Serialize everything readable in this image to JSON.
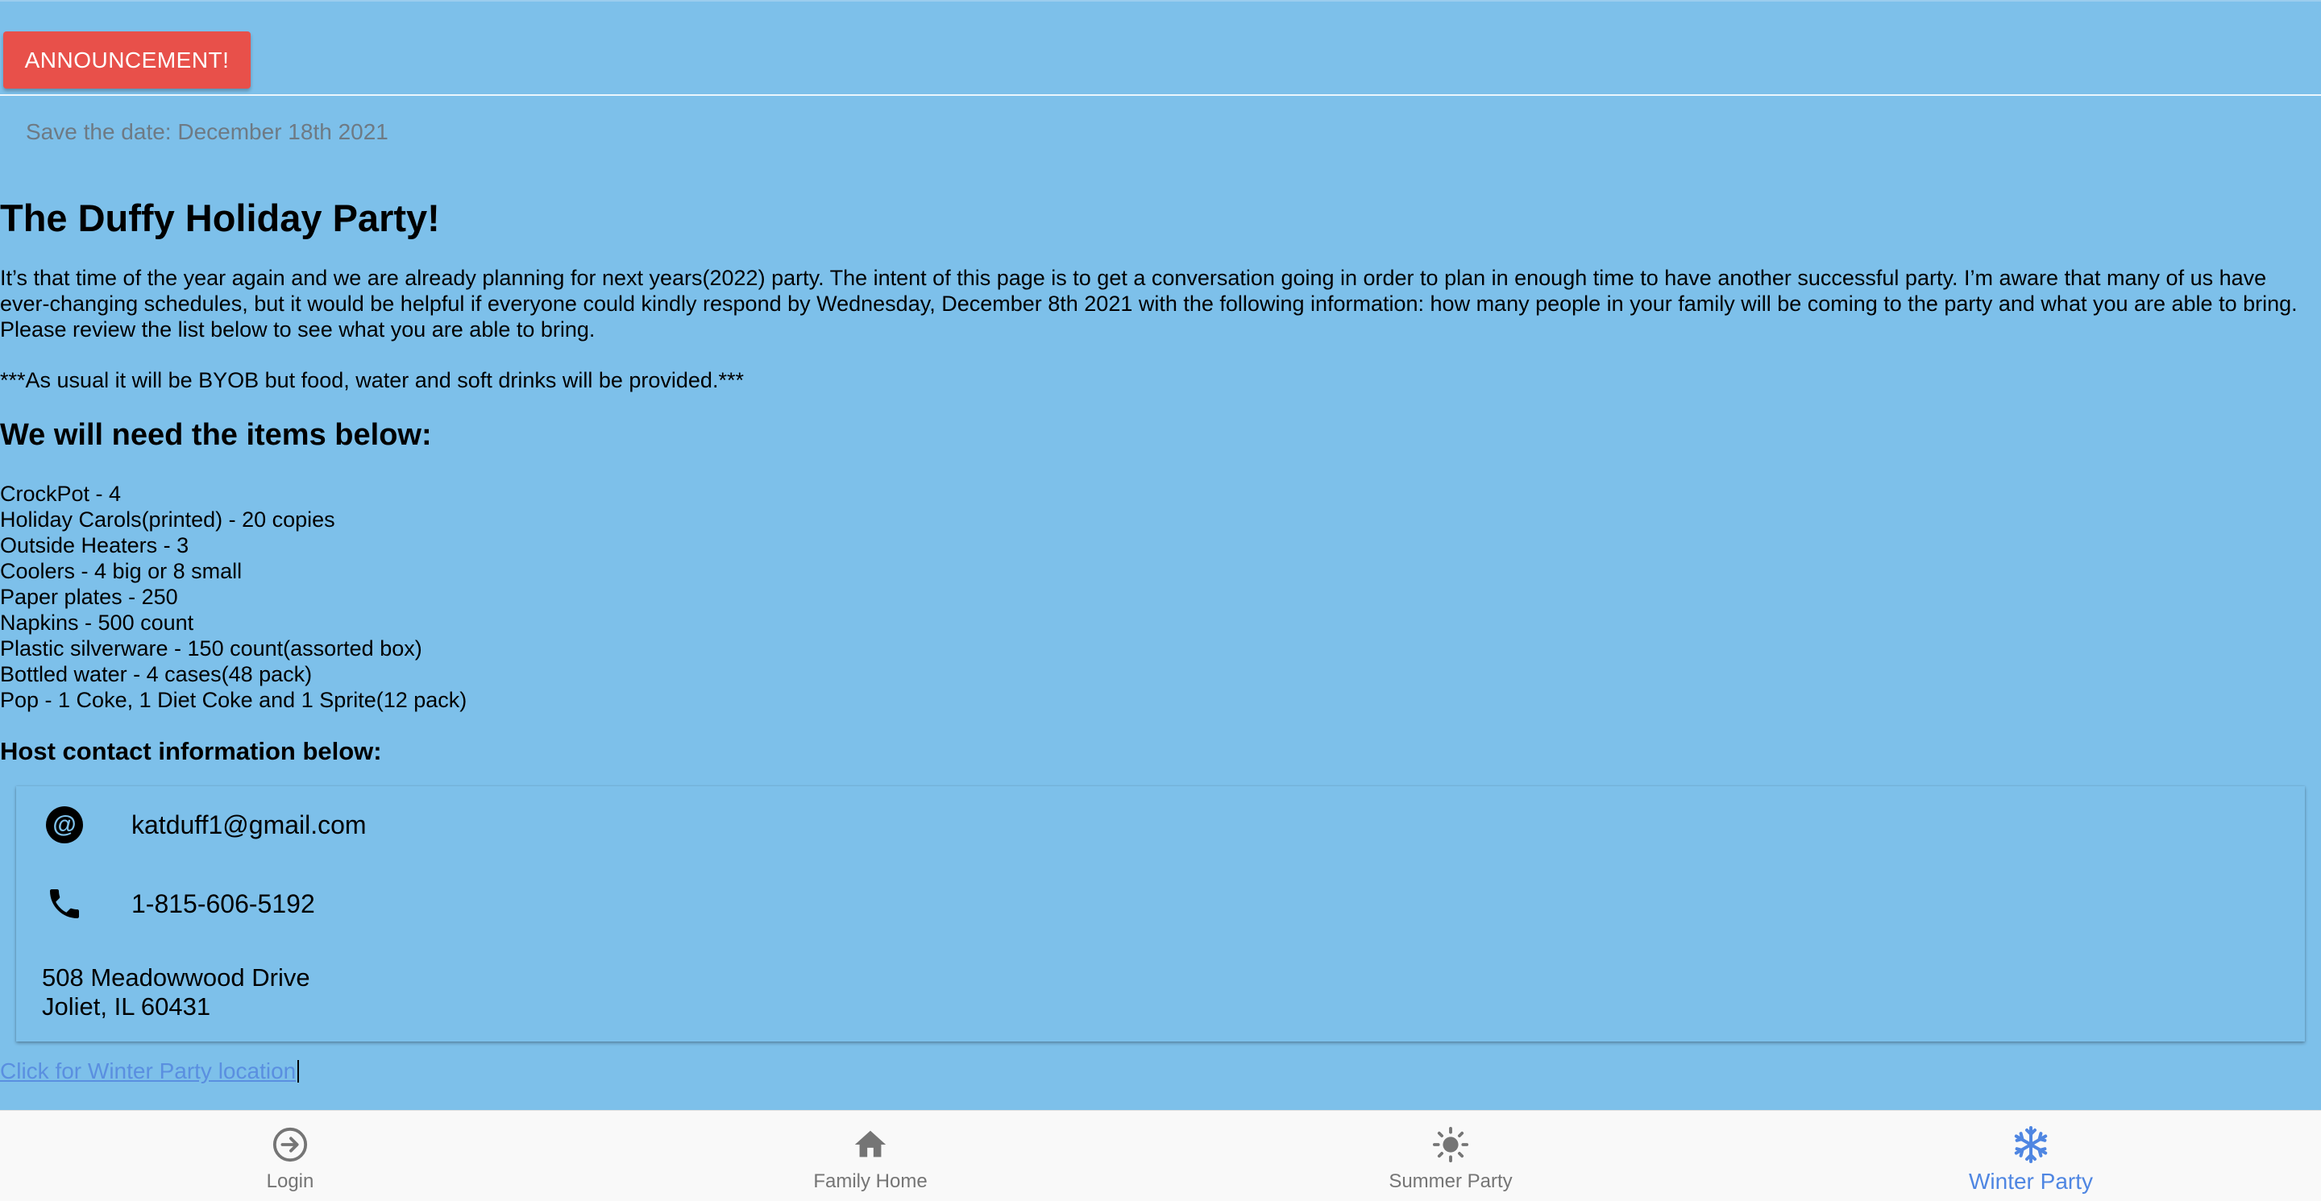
{
  "announcement_button": {
    "label": "ANNOUNCEMENT!"
  },
  "subheader": "Save the date: December 18th 2021",
  "title": "The Duffy Holiday Party!",
  "intro": "It’s that time of the year again and we are already planning for next years(2022) party. The intent of this page is to get a conversation going in order to plan in enough time to have another successful party. I’m aware that many of us have ever-changing schedules, but it would be helpful if everyone could kindly respond by Wednesday, December 8th 2021 with the following information: how many people in your family will be coming to the party and what you are able to bring. Please review the list below to see what you are able to bring.",
  "byob_note": "***As usual it will be BYOB but food, water and soft drinks will be provided.***",
  "items_heading": "We will need the items below:",
  "items": [
    "CrockPot - 4",
    "Holiday Carols(printed) - 20 copies",
    "Outside Heaters - 3",
    "Coolers - 4 big or 8 small",
    "Paper plates - 250",
    "Napkins - 500 count",
    "Plastic silverware - 150 count(assorted box)",
    "Bottled water - 4 cases(48 pack)",
    "Pop - 1 Coke, 1 Diet Coke and 1 Sprite(12 pack)"
  ],
  "host_heading": "Host contact information below:",
  "contact": {
    "email": "katduff1@gmail.com",
    "email_icon": "at-sign-icon",
    "phone": "1-815-606-5192",
    "phone_icon": "phone-icon",
    "address_line1": "508 Meadowwood Drive",
    "address_line2": "Joliet, IL 60431"
  },
  "location_link": "Click for Winter Party location",
  "bottom_nav": [
    {
      "label": "Login",
      "icon": "login-icon",
      "active": false
    },
    {
      "label": "Family Home",
      "icon": "home-icon",
      "active": false
    },
    {
      "label": "Summer Party",
      "icon": "sun-icon",
      "active": false
    },
    {
      "label": "Winter Party",
      "icon": "snowflake-icon",
      "active": true
    }
  ],
  "colors": {
    "background": "#7dc0ea",
    "announcement": "#e8504a",
    "link": "#5a8fe0",
    "nav_active": "#4f86e2",
    "nav_inactive": "#757575"
  }
}
